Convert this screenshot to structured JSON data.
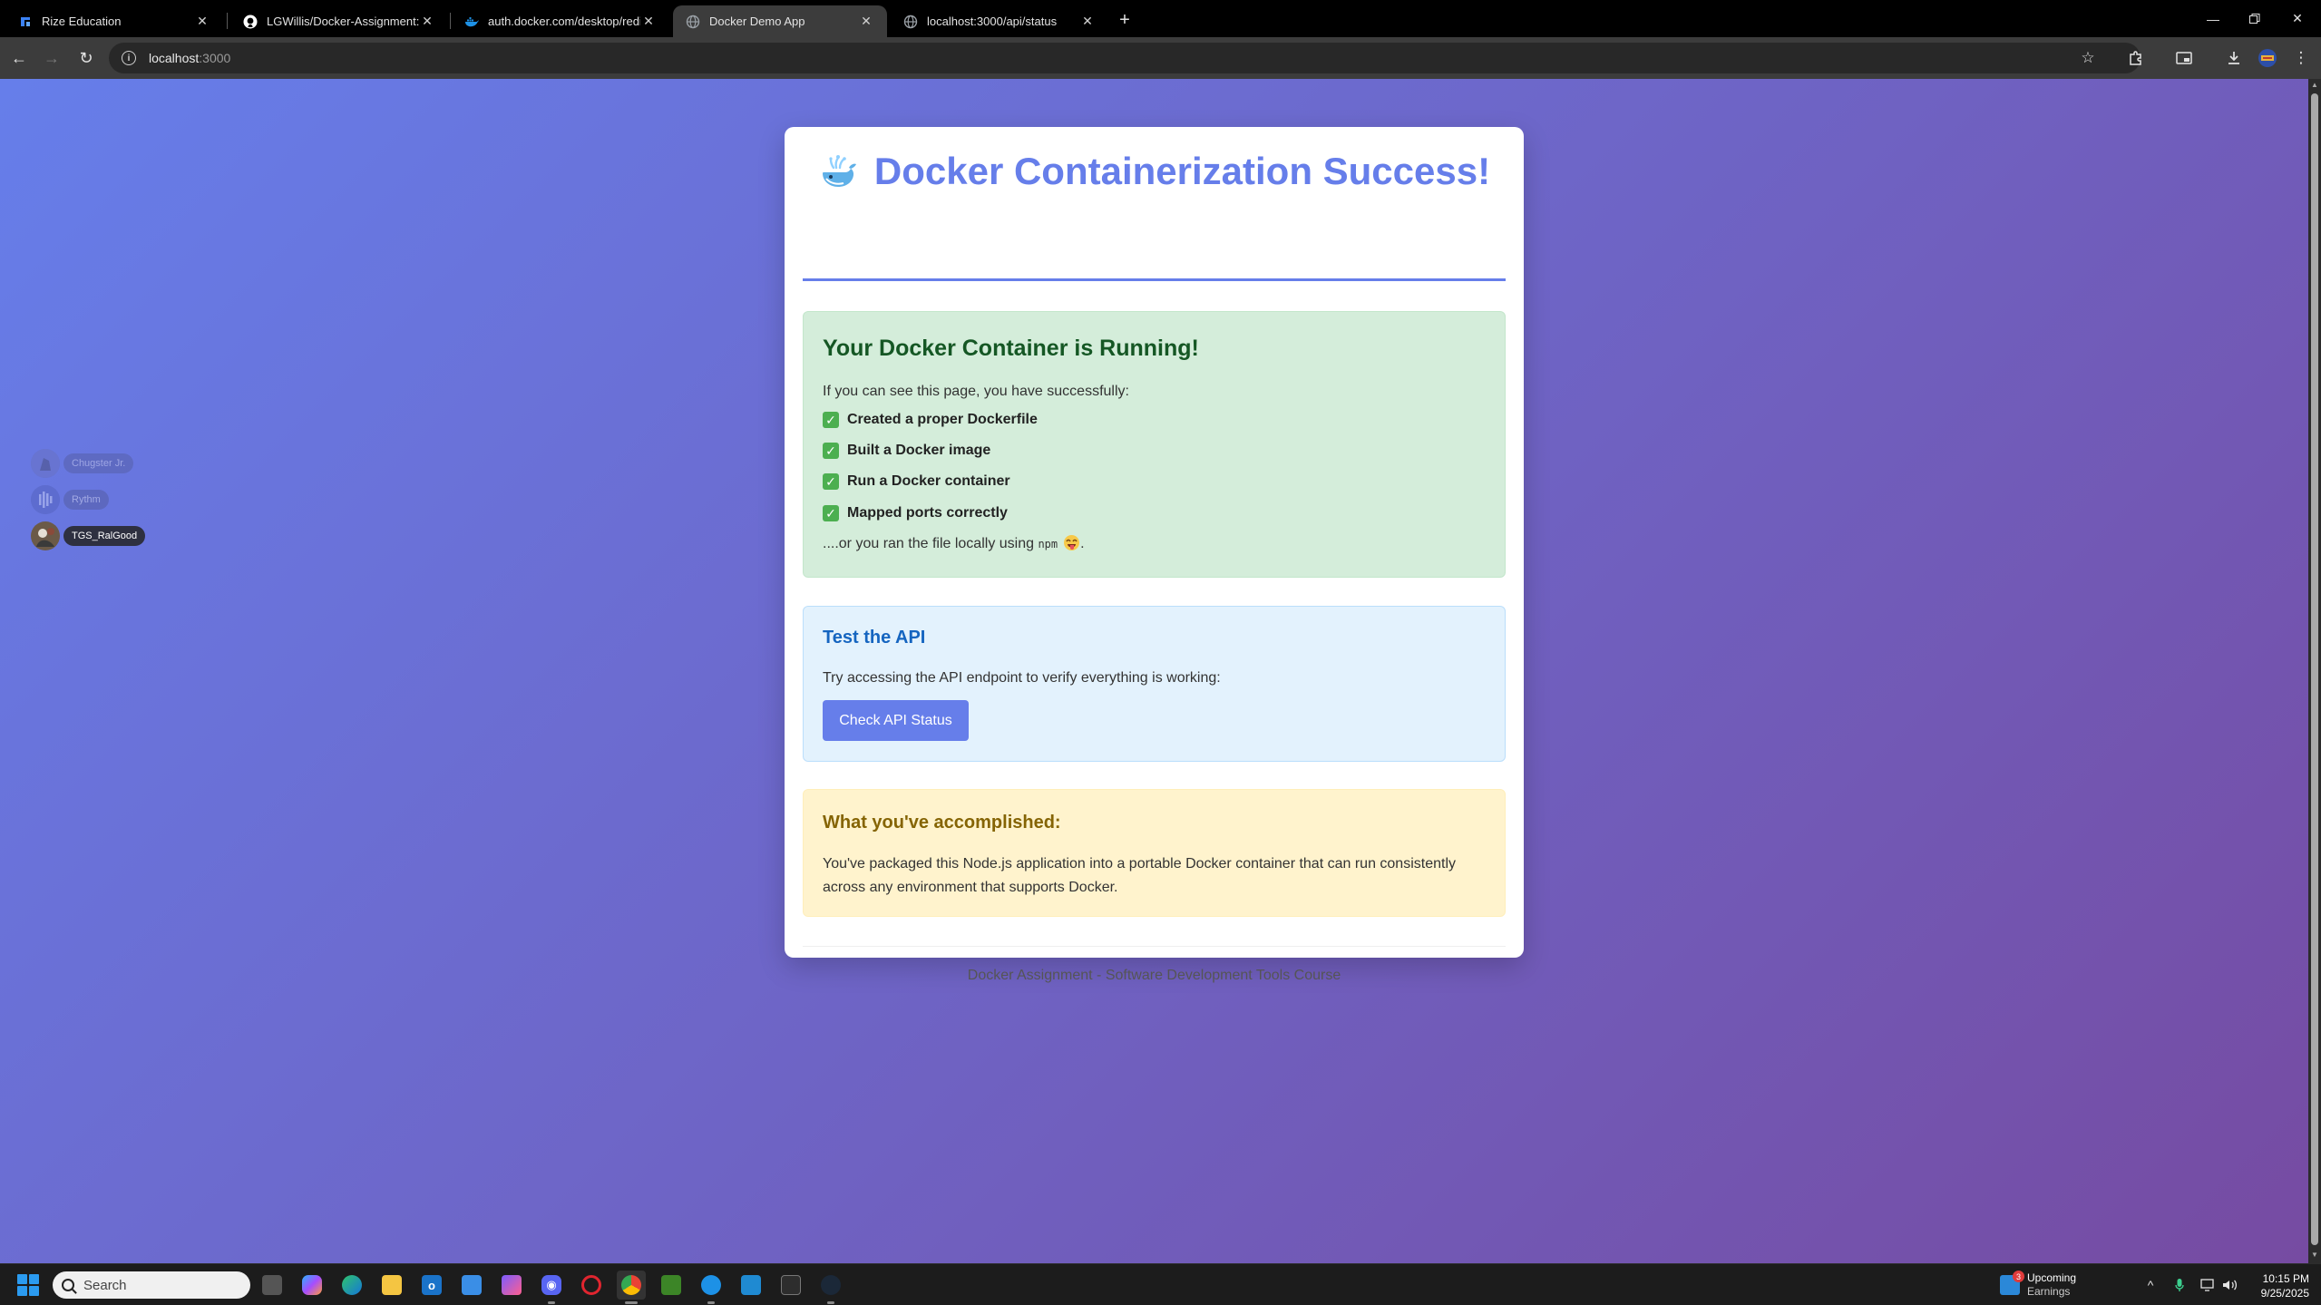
{
  "browser": {
    "tabs": [
      {
        "title": "Rize Education",
        "icon": "rize-icon"
      },
      {
        "title": "LGWillis/Docker-Assignment: M",
        "icon": "github-icon"
      },
      {
        "title": "auth.docker.com/desktop/redir",
        "icon": "docker-icon"
      },
      {
        "title": "Docker Demo App",
        "icon": "globe-icon",
        "active": true
      },
      {
        "title": "localhost:3000/api/status",
        "icon": "globe-icon"
      }
    ],
    "address": {
      "host": "localhost",
      "port": ":3000"
    }
  },
  "page": {
    "title": "Docker Containerization Success!",
    "success": {
      "title": "Your Docker Container is Running!",
      "intro": "If you can see this page, you have successfully:",
      "items": [
        "Created a proper Dockerfile",
        "Built a Docker image",
        "Run a Docker container",
        "Mapped ports correctly"
      ],
      "alt_prefix": "....or you ran the file locally using ",
      "alt_code": "npm",
      "alt_suffix": "."
    },
    "api": {
      "title": "Test the API",
      "text": "Try accessing the API endpoint to verify everything is working:",
      "button_label": "Check API Status"
    },
    "info": {
      "title": "What you've accomplished:",
      "text": "You've packaged this Node.js application into a portable Docker container that can run consistently across any environment that supports Docker."
    },
    "footer": "Docker Assignment - Software Development Tools Course"
  },
  "overlay": {
    "users": [
      {
        "name": "Chugster Jr."
      },
      {
        "name": "Rythm"
      },
      {
        "name": "TGS_RalGood"
      }
    ]
  },
  "taskbar": {
    "search_placeholder": "Search",
    "widget": {
      "badge": "3",
      "line1": "Upcoming",
      "line2": "Earnings"
    },
    "clock": {
      "time": "10:15 PM",
      "date": "9/25/2025"
    }
  },
  "colors": {
    "accent": "#667eea",
    "gradient_end": "#764ba2",
    "success_bg": "#d4edda",
    "api_bg": "#e3f2fd",
    "info_bg": "#fff3cd"
  }
}
